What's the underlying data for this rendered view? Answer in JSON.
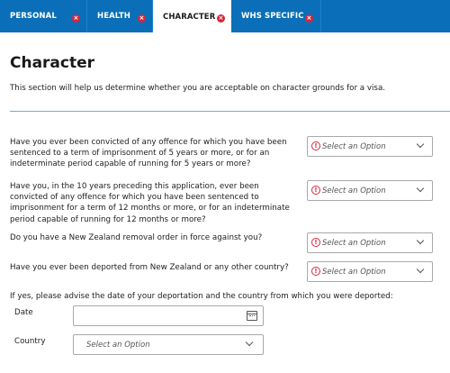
{
  "tabs": [
    {
      "label": "PERSONAL",
      "active": false,
      "closable": true
    },
    {
      "label": "HEALTH",
      "active": false,
      "closable": true
    },
    {
      "label": "CHARACTER",
      "active": true,
      "closable": true
    },
    {
      "label": "WHS SPECIFIC",
      "active": false,
      "closable": true
    }
  ],
  "page": {
    "title": "Character",
    "intro": "This section will help us determine whether you are acceptable on character grounds for a visa."
  },
  "questions": [
    {
      "text": "Have you ever been convicted of any offence for which you have been sentenced to a term of imprisonment of 5 years or more, or for an indeterminate period capable of running for 5 years or more?",
      "select_placeholder": "Select an Option"
    },
    {
      "text": "Have you, in the 10 years preceding this application, ever been convicted of any offence for which you have been sentenced to imprisonment for a term of 12 months or more, or for an indeterminate period capable of running for 12 months or more?",
      "select_placeholder": "Select an Option"
    },
    {
      "text": "Do you have a New Zealand removal order in force against you?",
      "select_placeholder": "Select an Option"
    },
    {
      "text": "Have you ever been deported from New Zealand or any other country?",
      "select_placeholder": "Select an Option"
    }
  ],
  "deportation": {
    "prompt": "If yes, please advise the date of your deportation and the country from which you were deported:",
    "date_label": "Date",
    "date_value": "",
    "country_label": "Country",
    "country_placeholder": "Select an Option"
  },
  "colors": {
    "tab_bar": "#0a6fb8",
    "close_badge": "#d9253a",
    "divider": "#66aee2",
    "warning": "#d9253a"
  },
  "icons": {
    "tab_close": "close-icon",
    "warning": "warning-icon",
    "dropdown": "chevron-down-icon",
    "calendar": "calendar-icon"
  }
}
